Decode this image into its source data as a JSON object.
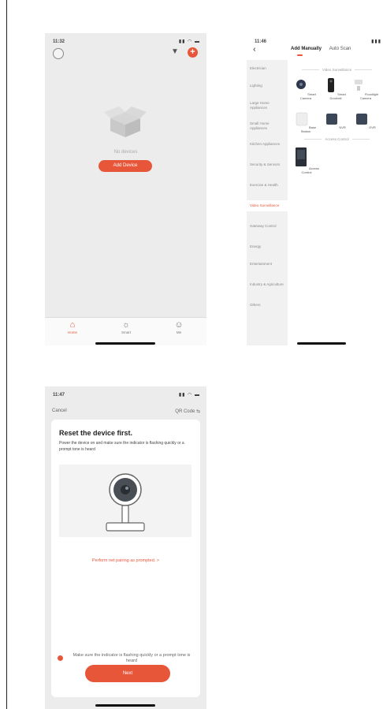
{
  "phone1": {
    "time": "11:32",
    "signal": "▮▮ ◠ ▬",
    "no_devices_text": "No devices",
    "add_device_label": "Add Device",
    "tabs": [
      {
        "label": "Home",
        "icon": "home-icon"
      },
      {
        "label": "Smart",
        "icon": "sun-icon"
      },
      {
        "label": "Me",
        "icon": "person-icon"
      }
    ],
    "accent_color": "#e8563a"
  },
  "phone2": {
    "time": "11:46",
    "signal": "▮▮▮",
    "tab_manual": "Add Manually",
    "tab_auto": "Auto Scan",
    "categories": [
      "Electrician",
      "Lighting",
      "Large Home Appliances",
      "Small Home Appliances",
      "Kitchen Appliances",
      "Security & Sensors",
      "Exercise & Health",
      "Video Surveillance",
      "Gateway Control",
      "Energy",
      "Entertainment",
      "Industry & Agriculture",
      "Others"
    ],
    "active_category": "Video Surveillance",
    "section_video": "Video Surveillance",
    "section_access": "Access Control",
    "video_devices": [
      "Smart Camera",
      "Smart Doorbell",
      "Floodlight Camera",
      "Base Station",
      "NVR",
      "DVR"
    ],
    "access_devices": [
      "Access Control"
    ]
  },
  "phone3": {
    "time": "11:47",
    "signal": "▮▮ ◠ ▬",
    "cancel_label": "Cancel",
    "qr_label": "QR Code ⇆",
    "title": "Reset the device first.",
    "description": "Power the device on and make sure the indicator is flashing quickly or a prompt tone is heard",
    "link_text": "Perform net pairing as prompted. >",
    "confirm_text": "Make sure the indicator is flashing quickly or a prompt tone is heard",
    "next_label": "Next"
  }
}
